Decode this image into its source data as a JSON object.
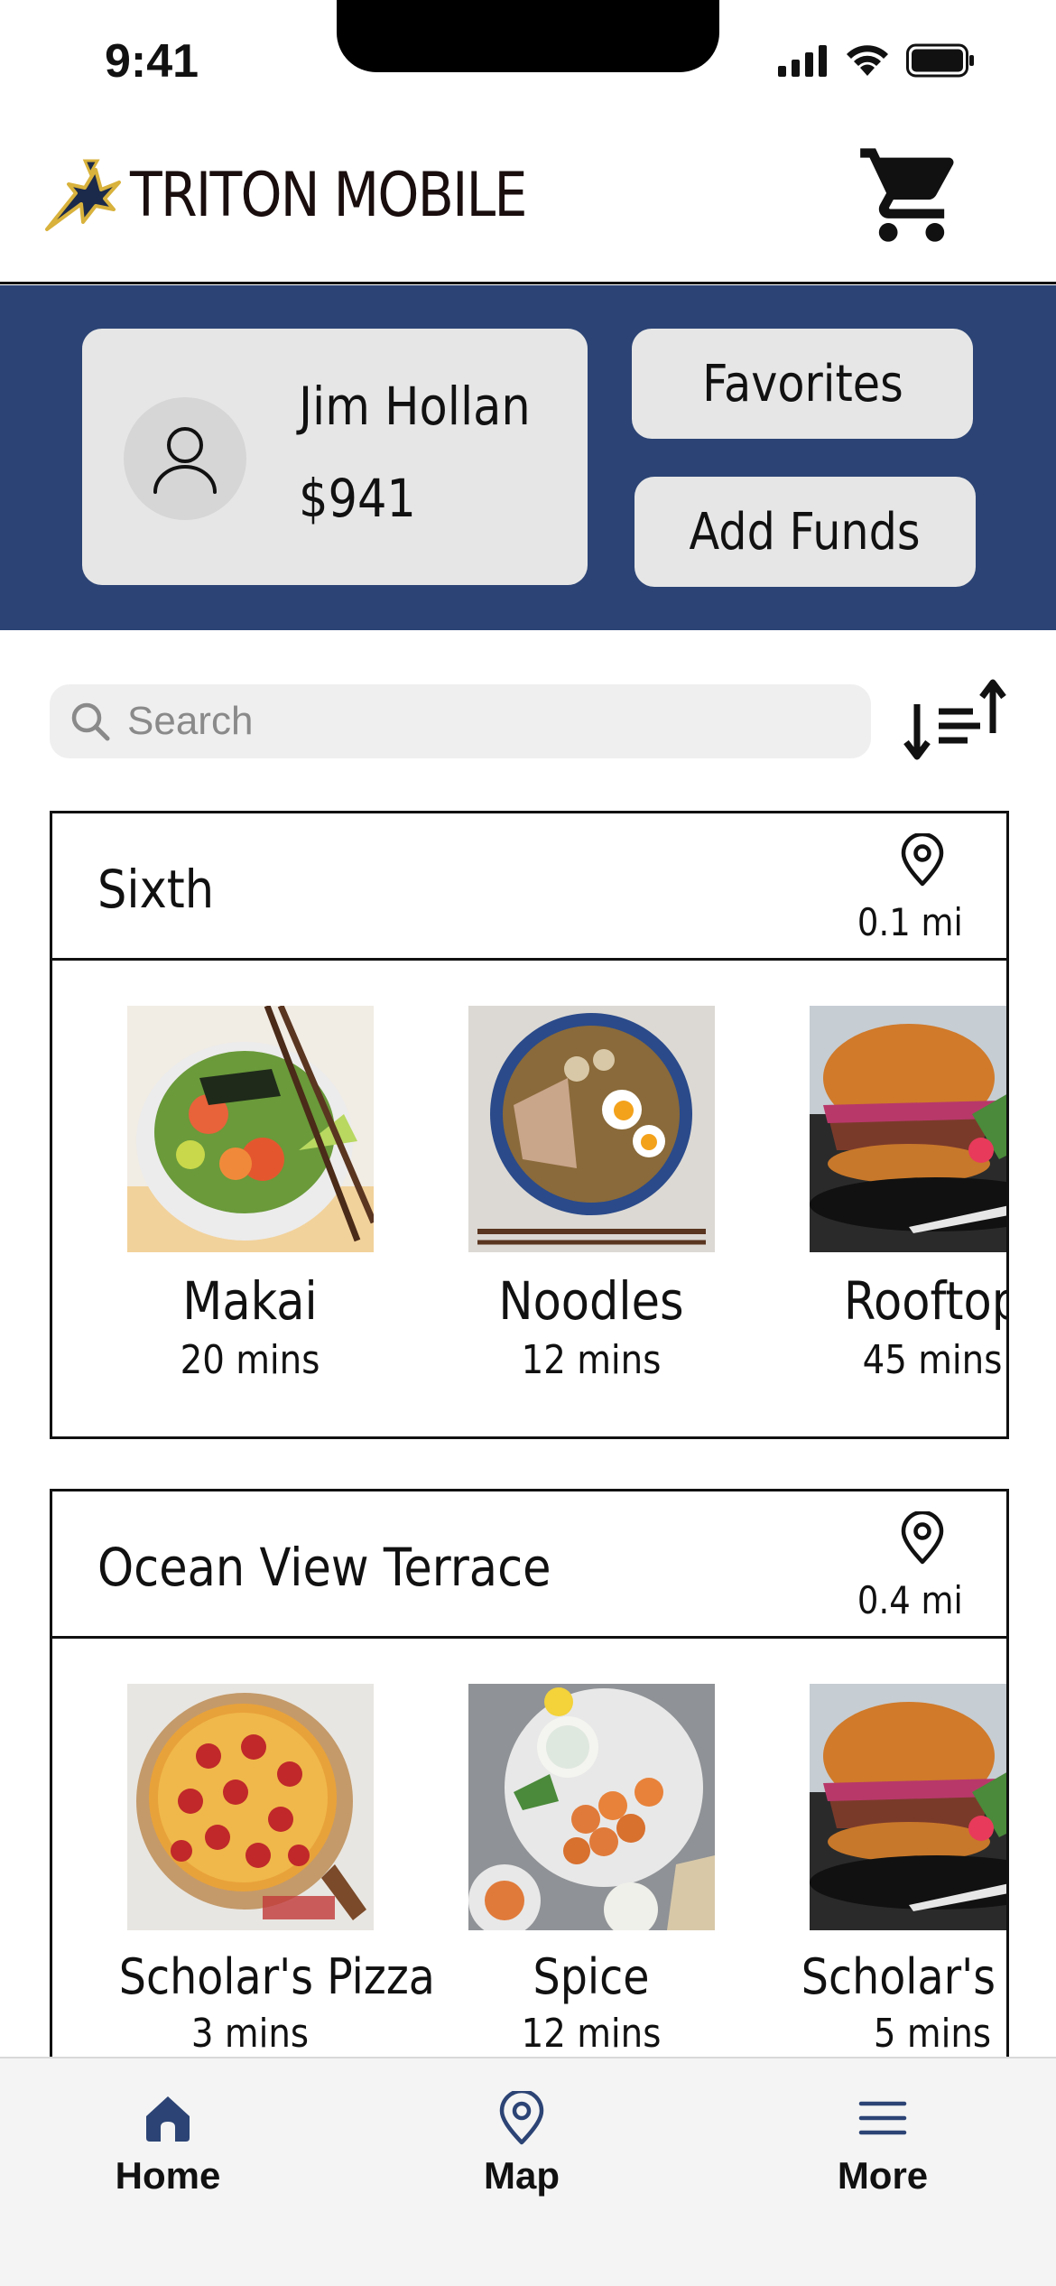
{
  "status_bar": {
    "time": "9:41"
  },
  "header": {
    "brand": "TRITON MOBILE"
  },
  "profile": {
    "name": "Jim Hollan",
    "balance": "$941"
  },
  "actions": {
    "favorites": "Favorites",
    "add_funds": "Add Funds"
  },
  "search": {
    "placeholder": "Search"
  },
  "sections": [
    {
      "title": "Sixth",
      "distance": "0.1 mi",
      "items": [
        {
          "name": "Makai",
          "time": "20 mins"
        },
        {
          "name": "Noodles",
          "time": "12 mins"
        },
        {
          "name": "Rooftop",
          "time": "45 mins"
        }
      ]
    },
    {
      "title": "Ocean View Terrace",
      "distance": "0.4 mi",
      "items": [
        {
          "name": "Scholar's Pizza",
          "time": "3 mins"
        },
        {
          "name": "Spice",
          "time": "12 mins"
        },
        {
          "name": "Scholar's Italian",
          "time": "5 mins"
        }
      ]
    }
  ],
  "tabs": [
    {
      "label": "Home"
    },
    {
      "label": "Map"
    },
    {
      "label": "More"
    }
  ],
  "colors": {
    "band": "#2c4475",
    "tab_icon": "#2c4475",
    "card": "#e6e6e6"
  }
}
